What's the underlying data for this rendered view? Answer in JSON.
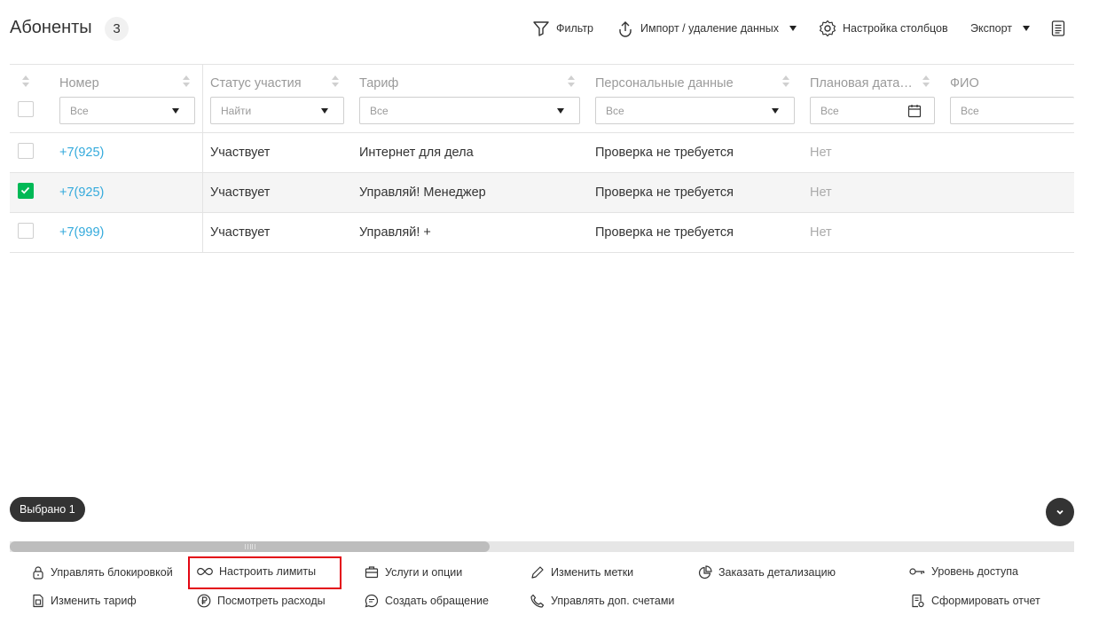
{
  "header": {
    "title": "Абоненты",
    "count": "3",
    "toolbar": {
      "filter_label": "Фильтр",
      "import_label": "Импорт / удаление данных",
      "columns_label": "Настройка столбцов",
      "export_label": "Экспорт"
    }
  },
  "table": {
    "columns": [
      {
        "label": "Номер",
        "filter": "Все"
      },
      {
        "label": "Статус участия",
        "filter": "Найти"
      },
      {
        "label": "Тариф",
        "filter": "Все"
      },
      {
        "label": "Персональные данные",
        "filter": "Все"
      },
      {
        "label": "Плановая дата…",
        "filter": "Все"
      },
      {
        "label": "ФИО",
        "filter": "Все"
      }
    ],
    "rows": [
      {
        "number": "+7(925)",
        "status": "Участвует",
        "tariff": "Интернет для дела",
        "personal": "Проверка не требуется",
        "planned": "Нет",
        "checked": false
      },
      {
        "number": "+7(925)",
        "status": "Участвует",
        "tariff": "Управляй! Менеджер",
        "personal": "Проверка не требуется",
        "planned": "Нет",
        "checked": true
      },
      {
        "number": "+7(999)",
        "status": "Участвует",
        "tariff": "Управляй! +",
        "personal": "Проверка не требуется",
        "planned": "Нет",
        "checked": false
      }
    ]
  },
  "selection": {
    "label": "Выбрано 1"
  },
  "actions": {
    "manage_block": "Управлять блокировкой",
    "set_limits": "Настроить лимиты",
    "services": "Услуги и опции",
    "edit_tags": "Изменить метки",
    "order_details": "Заказать детализацию",
    "access_level": "Уровень доступа",
    "change_tariff": "Изменить тариф",
    "view_expenses": "Посмотреть расходы",
    "create_request": "Создать обращение",
    "manage_accounts": "Управлять доп. счетами",
    "make_report": "Сформировать отчет"
  },
  "colors": {
    "accent": "#00b956",
    "link": "#34aadc",
    "highlight": "#e30613",
    "dark": "#333333"
  }
}
